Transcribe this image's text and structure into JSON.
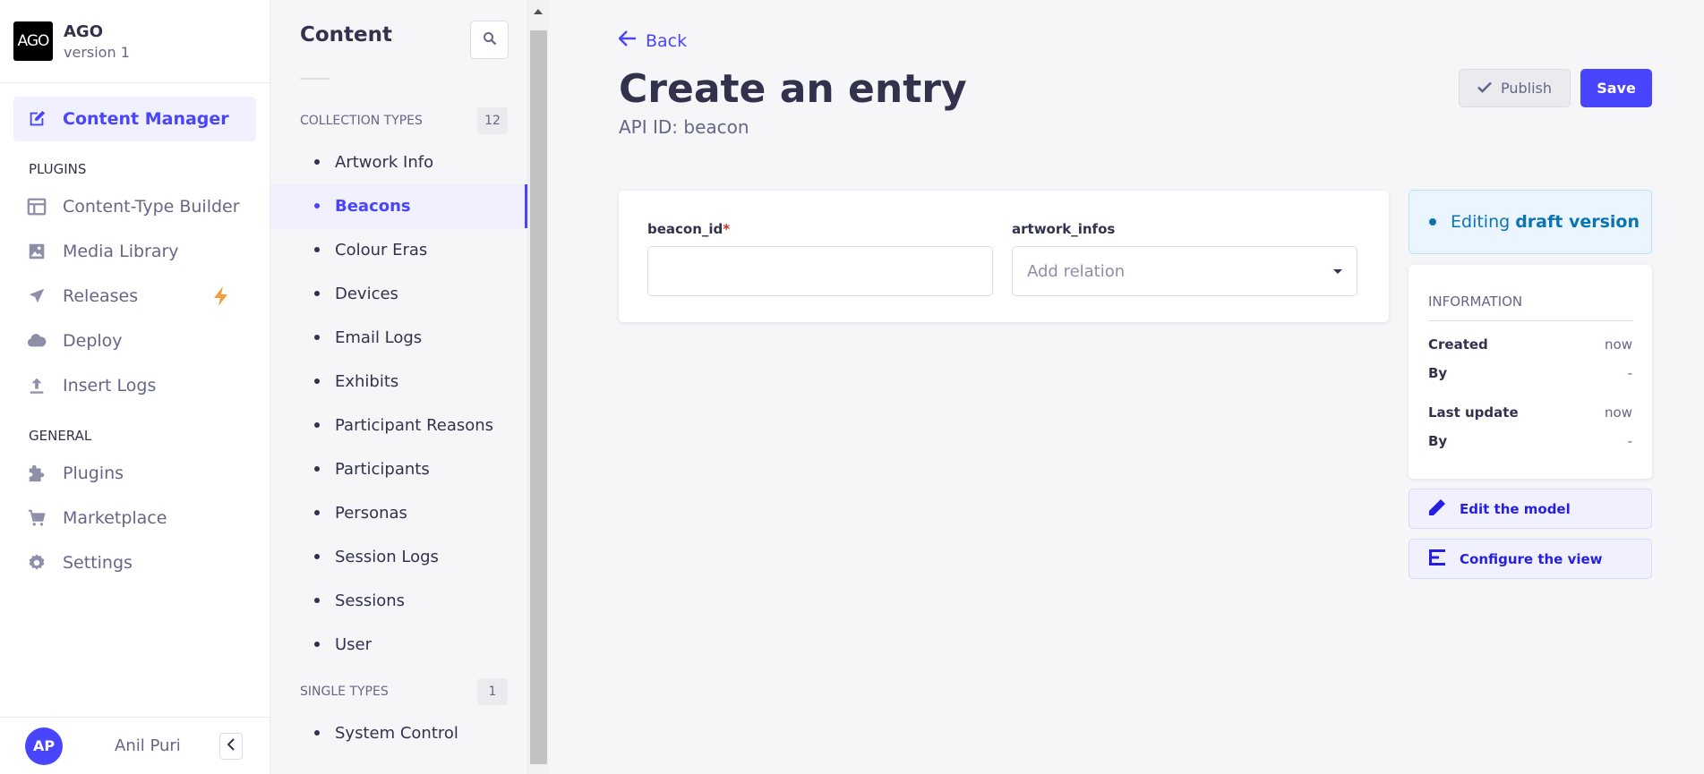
{
  "brand": {
    "logo_text": "AGO",
    "name": "AGO",
    "version": "version 1"
  },
  "mainnav": {
    "content_manager": "Content Manager",
    "plugins_header": "PLUGINS",
    "plugins": [
      {
        "label": "Content-Type Builder",
        "icon": "layout-icon"
      },
      {
        "label": "Media Library",
        "icon": "image-icon"
      },
      {
        "label": "Releases",
        "icon": "paper-plane-icon"
      },
      {
        "label": "Deploy",
        "icon": "cloud-icon"
      },
      {
        "label": "Insert Logs",
        "icon": "upload-icon"
      }
    ],
    "general_header": "GENERAL",
    "general": [
      {
        "label": "Plugins",
        "icon": "puzzle-icon"
      },
      {
        "label": "Marketplace",
        "icon": "cart-icon"
      },
      {
        "label": "Settings",
        "icon": "gear-icon"
      }
    ]
  },
  "user": {
    "initials": "AP",
    "name": "Anil Puri"
  },
  "subnav": {
    "title": "Content",
    "collection_header": "COLLECTION TYPES",
    "collection_count": "12",
    "collection_types": [
      "Artwork Info",
      "Beacons",
      "Colour Eras",
      "Devices",
      "Email Logs",
      "Exhibits",
      "Participant Reasons",
      "Participants",
      "Personas",
      "Session Logs",
      "Sessions",
      "User"
    ],
    "active_collection": "Beacons",
    "single_header": "SINGLE TYPES",
    "single_count": "1",
    "single_types": [
      "System Control"
    ]
  },
  "main": {
    "back": "Back",
    "title": "Create an entry",
    "api_id": "API ID: beacon",
    "publish": "Publish",
    "save": "Save",
    "fields": {
      "beacon_id_label": "beacon_id",
      "required_mark": "*",
      "beacon_id_value": "",
      "artwork_infos_label": "artwork_infos",
      "artwork_infos_placeholder": "Add relation"
    },
    "draft": {
      "prefix": "Editing",
      "bold": "draft version"
    },
    "info": {
      "title": "INFORMATION",
      "created_label": "Created",
      "created_value": "now",
      "created_by_label": "By",
      "created_by_value": "-",
      "updated_label": "Last update",
      "updated_value": "now",
      "updated_by_label": "By",
      "updated_by_value": "-"
    },
    "edit_model": "Edit the model",
    "configure_view": "Configure the view"
  },
  "colors": {
    "accent": "#4945ff",
    "draft_text": "#0c75af",
    "bolt": "#f29d41"
  }
}
